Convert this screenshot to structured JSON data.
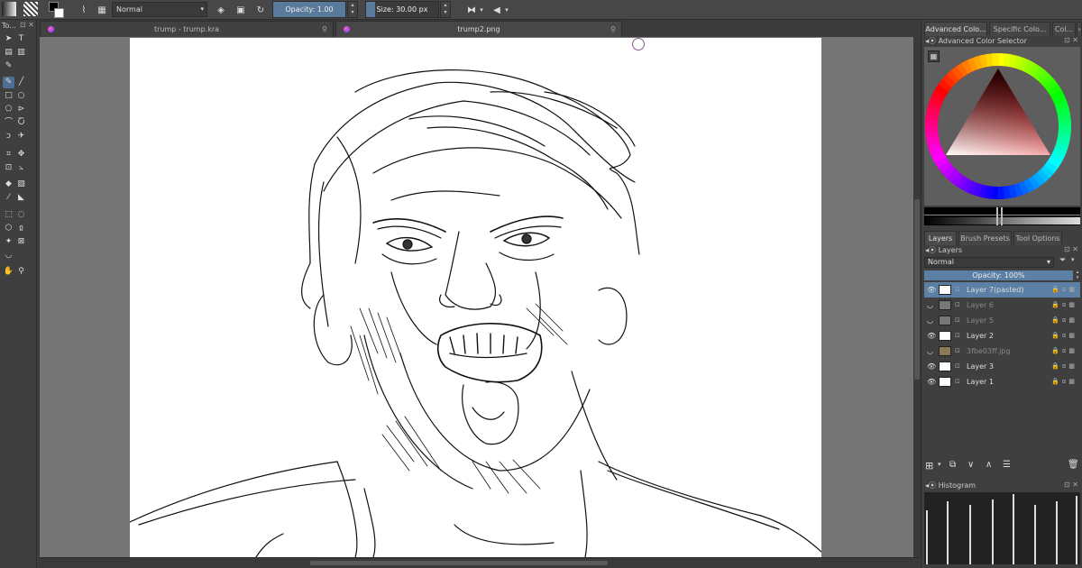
{
  "toolbar": {
    "blend_mode": "Normal",
    "opacity_label": "Opacity:",
    "opacity_value": "1.00",
    "opacity_fraction": 1.0,
    "size_label": "Size:",
    "size_value": "30.00 px",
    "size_fraction": 0.12
  },
  "toolbox": {
    "title": "To...",
    "title_icons": "⊡ ✕"
  },
  "tabs": [
    {
      "label": "trump - trump.kra",
      "close": "⚲"
    },
    {
      "label": "trump2.png",
      "close": "⚲"
    }
  ],
  "docker": {
    "top_tabs": [
      "Advanced Colo...",
      "Specific Colo...",
      "Col..."
    ],
    "color_selector_title": "Advanced Color Selector",
    "panel_tabs": [
      "Layers",
      "Brush Presets",
      "Tool Options"
    ],
    "layers_title": "Layers",
    "layers_blend_mode": "Normal",
    "layers_opacity_label": "Opacity:  100%",
    "layers": [
      {
        "name": "Layer 7(pasted)",
        "selected": true,
        "visible": true,
        "thumb": "sketch"
      },
      {
        "name": "Layer 6",
        "selected": false,
        "visible": false,
        "thumb": "grey"
      },
      {
        "name": "Layer 5",
        "selected": false,
        "visible": false,
        "thumb": "grey"
      },
      {
        "name": "Layer 2",
        "selected": false,
        "visible": true,
        "thumb": "sketch"
      },
      {
        "name": "3fbe03ff.jpg",
        "selected": false,
        "visible": false,
        "thumb": "img"
      },
      {
        "name": "Layer 3",
        "selected": false,
        "visible": true,
        "thumb": "white"
      },
      {
        "name": "Layer 1",
        "selected": false,
        "visible": true,
        "thumb": "white"
      }
    ],
    "histogram_title": "Histogram",
    "title_icons": "⊡ ✕"
  },
  "colors": {
    "accent": "#5b7fa5",
    "canvas_bg": "#757575",
    "paper": "#ffffff",
    "panel": "#3f3f3f"
  },
  "icons": {
    "layer_add": "plus-icon",
    "layer_duplicate": "duplicate-icon",
    "layer_down": "arrow-down-icon",
    "layer_up": "arrow-up-icon",
    "layer_props": "properties-icon",
    "layer_delete": "trash-icon"
  }
}
